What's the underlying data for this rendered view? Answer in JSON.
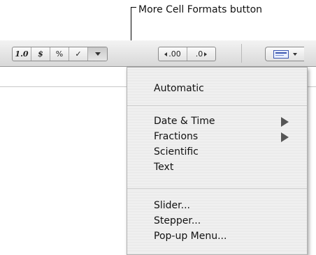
{
  "callout": {
    "label": "More Cell Formats button"
  },
  "toolbar": {
    "format_number": "1.0",
    "format_currency": "$",
    "format_percent": "%",
    "format_checkbox": "✓",
    "decrease_decimals": ".00",
    "increase_decimals": ".0"
  },
  "menu": {
    "items": [
      {
        "label": "Automatic"
      },
      {
        "label": "Date & Time"
      },
      {
        "label": "Fractions"
      },
      {
        "label": "Scientific"
      },
      {
        "label": "Text"
      },
      {
        "label": "Slider..."
      },
      {
        "label": "Stepper..."
      },
      {
        "label": "Pop-up Menu..."
      }
    ]
  }
}
